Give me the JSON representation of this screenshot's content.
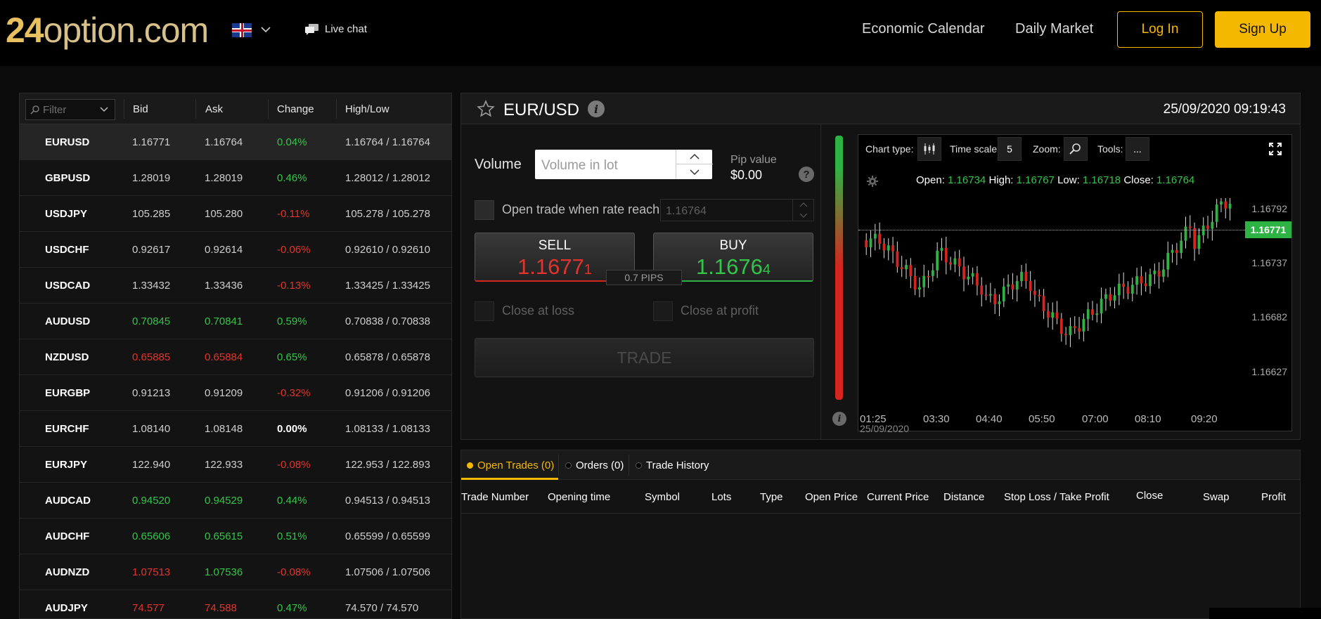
{
  "header": {
    "logo_num": "24",
    "logo_rest": "option.com",
    "live_chat": "Live chat",
    "nav": [
      "Economic Calendar",
      "Daily Market"
    ],
    "login": "Log In",
    "signup": "Sign Up"
  },
  "quotes": {
    "filter_placeholder": "Filter",
    "columns": [
      "Bid",
      "Ask",
      "Change",
      "High/Low"
    ],
    "rows": [
      {
        "symbol": "EURUSD",
        "bid": "1.16771",
        "ask": "1.16764",
        "change": "0.04%",
        "hl": "1.16764 / 1.16764"
      },
      {
        "symbol": "GBPUSD",
        "bid": "1.28019",
        "ask": "1.28019",
        "change": "0.46%",
        "hl": "1.28012 / 1.28012"
      },
      {
        "symbol": "USDJPY",
        "bid": "105.285",
        "ask": "105.280",
        "change": "-0.11%",
        "hl": "105.278 / 105.278"
      },
      {
        "symbol": "USDCHF",
        "bid": "0.92617",
        "ask": "0.92614",
        "change": "-0.06%",
        "hl": "0.92610 / 0.92610"
      },
      {
        "symbol": "USDCAD",
        "bid": "1.33432",
        "ask": "1.33436",
        "change": "-0.13%",
        "hl": "1.33425 / 1.33425"
      },
      {
        "symbol": "AUDUSD",
        "bid": "0.70845",
        "ask": "0.70841",
        "change": "0.59%",
        "hl": "0.70838 / 0.70838"
      },
      {
        "symbol": "NZDUSD",
        "bid": "0.65885",
        "ask": "0.65884",
        "change": "0.65%",
        "hl": "0.65878 / 0.65878"
      },
      {
        "symbol": "EURGBP",
        "bid": "0.91213",
        "ask": "0.91209",
        "change": "-0.32%",
        "hl": "0.91206 / 0.91206"
      },
      {
        "symbol": "EURCHF",
        "bid": "1.08140",
        "ask": "1.08148",
        "change": "0.00%",
        "hl": "1.08133 / 1.08133"
      },
      {
        "symbol": "EURJPY",
        "bid": "122.940",
        "ask": "122.933",
        "change": "-0.08%",
        "hl": "122.953 / 122.893"
      },
      {
        "symbol": "AUDCAD",
        "bid": "0.94520",
        "ask": "0.94529",
        "change": "0.44%",
        "hl": "0.94513 / 0.94513"
      },
      {
        "symbol": "AUDCHF",
        "bid": "0.65606",
        "ask": "0.65615",
        "change": "0.51%",
        "hl": "0.65599 / 0.65599"
      },
      {
        "symbol": "AUDNZD",
        "bid": "1.07513",
        "ask": "1.07536",
        "change": "-0.08%",
        "hl": "1.07506 / 1.07506"
      },
      {
        "symbol": "AUDJPY",
        "bid": "74.577",
        "ask": "74.588",
        "change": "0.47%",
        "hl": "74.570 / 74.570"
      }
    ]
  },
  "trade": {
    "symbol": "EUR/USD",
    "datetime": "25/09/2020 09:19:43",
    "volume_label": "Volume",
    "volume_placeholder": "Volume in lot",
    "pip_label": "Pip value",
    "pip_value": "$0.00",
    "open_when_label": "Open trade when rate reach",
    "rate_value": "1.16764",
    "sell_label": "SELL",
    "sell_price_main": "1.1677",
    "sell_price_small": "1",
    "buy_label": "BUY",
    "buy_price_main": "1.1676",
    "buy_price_small": "4",
    "pips": "0.7 PIPS",
    "close_loss": "Close at loss",
    "close_profit": "Close at profit",
    "trade_btn": "TRADE"
  },
  "chart": {
    "chart_type_label": "Chart type:",
    "time_scale_label": "Time scale",
    "time_scale_value": "5",
    "zoom_label": "Zoom:",
    "tools_label": "Tools:",
    "tools_value": "...",
    "open_label": "Open:",
    "open": "1.16734",
    "high_label": "High:",
    "high": "1.16767",
    "low_label": "Low:",
    "low": "1.16718",
    "close_label": "Close:",
    "close": "1.16764",
    "current_tag": "1.16771",
    "yticks": [
      "1.16792",
      "1.16737",
      "1.16682",
      "1.16627"
    ],
    "xticks": [
      "01:25",
      "03:30",
      "04:40",
      "05:50",
      "07:00",
      "08:10",
      "09:20"
    ],
    "date": "25/09/2020"
  },
  "bottom": {
    "tabs": [
      "Open Trades (0)",
      "Orders (0)",
      "Trade History"
    ],
    "columns": [
      "Trade Number",
      "Opening time",
      "Symbol",
      "Lots",
      "Type",
      "Open Price",
      "Current Price",
      "Distance",
      "Stop Loss / Take Profit",
      "Close",
      "Swap",
      "Profit"
    ]
  },
  "colors": {
    "accent": "#f5b800",
    "up": "#35c44a",
    "down": "#e0342e"
  }
}
